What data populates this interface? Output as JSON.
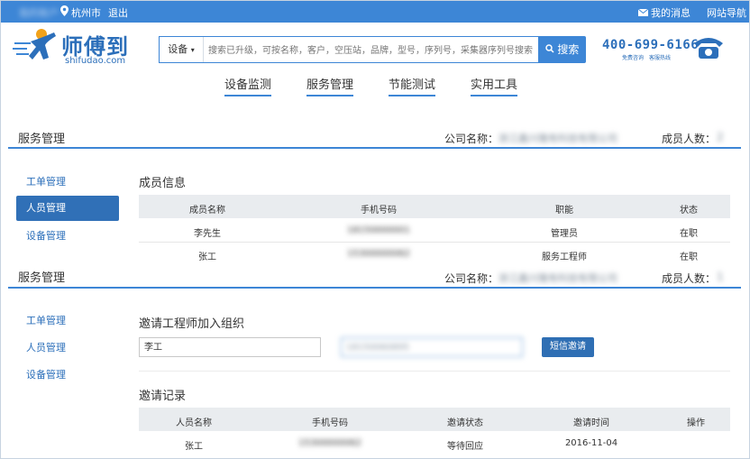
{
  "topbar": {
    "user": "我的账户",
    "location_icon": "map-pin-icon",
    "city": "杭州市",
    "logout": "退出",
    "messages_icon": "envelope-icon",
    "messages": "我的消息",
    "site_nav": "网站导航"
  },
  "header": {
    "logo_cn": "师傅到",
    "logo_en": "shifudao.com",
    "search_category": "设备",
    "search_placeholder": "搜索已升级，可按名称，客户，空压站，品牌，型号，序列号，采集器序列号搜索",
    "search_button": "搜索",
    "phone": "400-699-6166",
    "phone_sub": "免费咨询　客服热线"
  },
  "nav": [
    "设备监测",
    "服务管理",
    "节能测试",
    "实用工具"
  ],
  "section1": {
    "title": "服务管理",
    "company_label": "公司名称：",
    "company_value": "浙江鑫兴隆有科技有限公司",
    "members_label": "成员人数：",
    "members_value": "2",
    "sidebar": [
      "工单管理",
      "人员管理",
      "设备管理"
    ],
    "active_sidebar": 1,
    "heading": "成员信息",
    "columns": [
      "成员名称",
      "手机号码",
      "职能",
      "状态"
    ],
    "rows": [
      [
        "李先生",
        "18150000001",
        "管理员",
        "在职"
      ],
      [
        "张工",
        "15300000062",
        "服务工程师",
        "在职"
      ]
    ]
  },
  "section2": {
    "title": "服务管理",
    "company_label": "公司名称：",
    "company_value": "浙江鑫兴隆有科技有限公司",
    "members_label": "成员人数：",
    "members_value": "1",
    "sidebar": [
      "工单管理",
      "人员管理",
      "设备管理"
    ],
    "invite_heading": "邀请工程师加入组织",
    "name_value": "李工",
    "phone_value": "18150060895",
    "invite_button": "短信邀请",
    "record_heading": "邀请记录",
    "columns": [
      "人员名称",
      "手机号码",
      "邀请状态",
      "邀请时间",
      "操作"
    ],
    "rows": [
      [
        "张工",
        "15300000062",
        "等待回应",
        "2016-11-04",
        ""
      ]
    ]
  },
  "colors": {
    "brand": "#3d86d6",
    "active": "#3070b7"
  }
}
